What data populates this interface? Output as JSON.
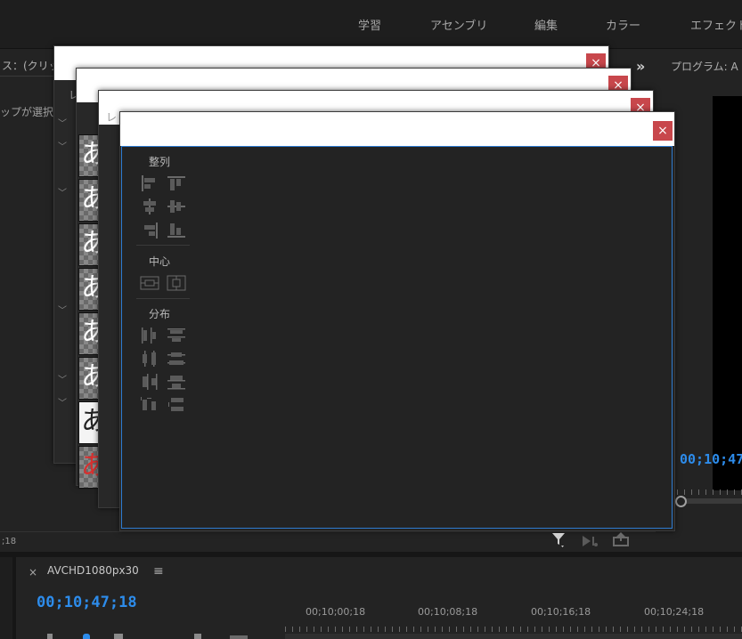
{
  "workspace_tabs": [
    "学習",
    "アセンブリ",
    "編集",
    "カラー",
    "エフェクト"
  ],
  "source_panel": {
    "title": "ス：(クリッ",
    "subtitle": "ップが選択",
    "timecode": ";18"
  },
  "program_monitor": {
    "title": "プログラム: A",
    "expand_label": "»",
    "timecode": "00;10;47"
  },
  "dialogs": {
    "close_symbol": "×",
    "tab_label": "レ",
    "thumb_glyph": "あ"
  },
  "align_panel": {
    "sections": {
      "align": "整列",
      "center": "中心",
      "distribute": "分布"
    }
  },
  "timeline": {
    "close_symbol": "×",
    "sequence_name": "AVCHD1080px30",
    "menu_symbol": "≡",
    "timecode": "00;10;47;18",
    "ruler_labels": [
      "00;10;00;18",
      "00;10;08;18",
      "00;10;16;18",
      "00;10;24;18"
    ]
  },
  "colors": {
    "accent_blue": "#2d8ceb",
    "close_red": "#c8474c",
    "panel_bg": "#232323"
  }
}
